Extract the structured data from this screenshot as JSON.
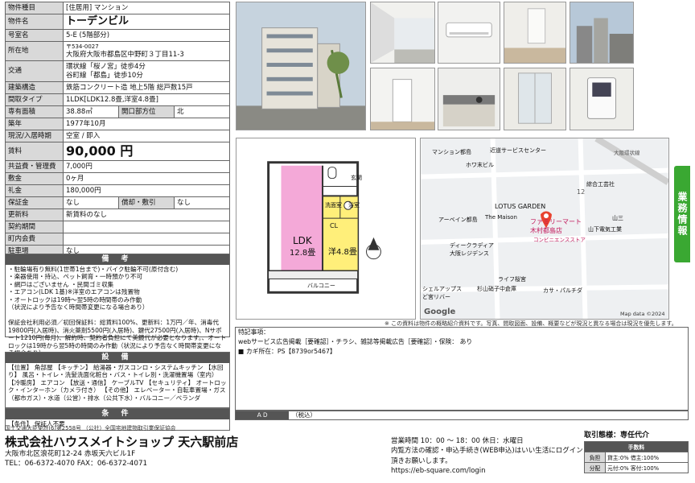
{
  "spec": {
    "category_label": "物件種目",
    "category_value": "[住居用] マンション",
    "name_label": "物件名",
    "name_value": "トーデンビル",
    "room_label": "号室名",
    "room_value": "5-E (5階部分)",
    "address_label": "所在地",
    "zip": "〒534-0027",
    "address": "大阪府大阪市都島区中野町３丁目11-3",
    "transit_label": "交通",
    "transit_1": "環状線「桜ノ宮」徒歩4分",
    "transit_2": "谷町線「都島」徒歩10分",
    "structure_label": "建築構造",
    "structure_value": "鉄筋コンクリート造 地上5階 総戸数15戸",
    "layout_label": "間取タイプ",
    "layout_value": "1LDK[LDK12.8畳,洋室4.8畳]",
    "area_label": "専有面積",
    "area_value": "38.88㎡",
    "direction_label": "開口部方位",
    "direction_value": "北",
    "built_label": "築年",
    "built_value": "1977年10月",
    "status_label": "現況/入居時期",
    "status_value": "空室 / 即入",
    "rent_label": "賃料",
    "rent_value": "90,000 円",
    "common_label": "共益費・管理費",
    "common_value": "7,000円",
    "deposit_label": "敷金",
    "deposit_value": "0ヶ月",
    "key_label": "礼金",
    "key_value": "180,000円",
    "guarantee_label": "保証金",
    "guarantee_value": "なし",
    "amort_label": "償却・敷引",
    "amort_value": "なし",
    "renewal_label": "更新料",
    "renewal_value": "新賃料のなし",
    "term_label": "契約期間",
    "term_value": "",
    "assoc_label": "町内会費",
    "assoc_value": "",
    "parking_label": "駐車場",
    "parking_value": "なし"
  },
  "remarks": {
    "title": "備 考",
    "text": "・駐輪場有り無料(1世帯1台まで)・バイク駐輪不可(原付含む)\n・楽器使用・持込、ペット飼育・一時預かり不可\n・網戸はございません ・民間ゴミ収集\n・エアコン(LDK 1基)※洋室のエアコンは残置物\n・オートロックは19時～翌5時の時間帯のみ作動\n（状況により予告なく時間帯変更になる場合あり）\n\n保証会社利用必須／初回保証料：総賃料100%、更新料：1万円／年、消毒代19800円(入居時)、消火薬剤5500円(入居時)、鍵代27500円(入居時)、Nサポート1210円(毎月)、解約時、契約者負担にて美鏡代が必要となります。、オートロックは19時から翌5時の時間のみ作動（状況により予告なく時間帯変更になる場合あり）"
  },
  "equip": {
    "title": "設 備",
    "text": "【位置】 角部屋 【キッチン】 給湯器・ガスコンロ・システムキッチン 【水回り】 風呂・トイレ・洗髪洗面化粧台・バス・トイレ別・洗濯機置場（室内） 【冷暖房】 エアコン 【放送・通信】 ケーブルTV 【セキュリティ】 オートロック・インターホン（カメラ付き） 【その他】 エレベーター・自転車置場・ガス（都市ガス）・水道（公営）・排水（公共下水）・バルコニー／ベランダ"
  },
  "cond": {
    "title": "条 件",
    "text": "【条件】 保証人不要"
  },
  "floor": {
    "entrance": "玄関",
    "wash": "洗面室",
    "bath": "浴室",
    "cl": "CL",
    "ldk": "LDK",
    "ldk_size": "12.8畳",
    "western": "洋4.8畳",
    "balcony": "バルコニー"
  },
  "map": {
    "labels": [
      "マンション都島",
      "近道サービスセンター",
      "ホワ末ビル",
      "綜合工芸社",
      "LOTUS GARDEN",
      "The Maison",
      "アーベイン都島",
      "ファミリーマート",
      "木村都島店",
      "コンビニエンスストア",
      "山三",
      "山下電気工業",
      "ディークラディア",
      "大阪レジデンス",
      "ライフ桜宮",
      "シェルアップス",
      "ど宮リバー",
      "杉山硝子中倉庫",
      "カサ・パルチダ",
      "大阪環状線",
      "12"
    ],
    "google": "Google",
    "copyright": "Map data ©2024"
  },
  "note": "※ この資料は物件の概略紹介資料です。写真、間取図面、設備、概要などが現況と異なる場合は現況を優先します。",
  "special": {
    "title": "特記事項：",
    "line1": "webサービス広告掲載［要確認］・チラシ、雑誌等掲載広告［要確認］・保険： あり",
    "line2": "■ カギ所在：PS【8739or5467】"
  },
  "adbar": {
    "label": "ＡＤ",
    "value": "（税込）"
  },
  "license": "国土交通大臣免許(6)第2558号 （公社）全国宅地建物取引業保証協会",
  "company": {
    "name": "株式会社ハウスメイトショップ 天六駅前店",
    "address": "大阪市北区浪花町12-24 赤坂天六ビル1F",
    "tel": "TEL：06-6372-4070  FAX：06-6372-4071"
  },
  "hours": {
    "line1": "営業時間 10：00 ～ 18：00 休日：水曜日",
    "line2": "内覧方法の確認・申込手続き(WEB申込)はいい生活にログイン頂きお願いします。",
    "url": "https://eb-square.com/login"
  },
  "trade": {
    "title": "取引態様：専任代介",
    "fee_header": "手数料",
    "burden_label": "負担",
    "burden_value": "貸主:0% 借主:100%",
    "dist_label": "分配",
    "dist_value": "元付:0% 客付:100%"
  },
  "sidetab": "業務情報"
}
